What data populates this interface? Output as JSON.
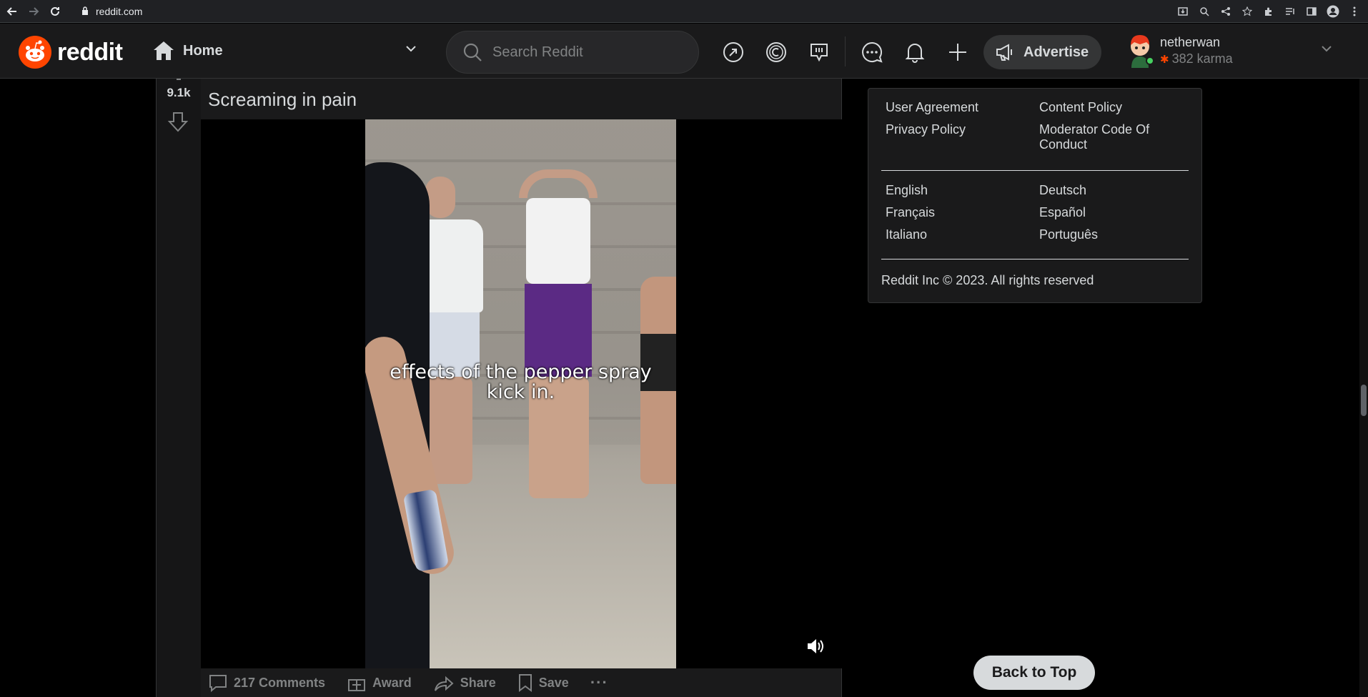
{
  "browser": {
    "url": "reddit.com"
  },
  "header": {
    "logo_text": "reddit",
    "feed_label": "Home",
    "search_placeholder": "Search Reddit",
    "advertise_label": "Advertise",
    "user": {
      "name": "netherwan",
      "karma": "382 karma"
    },
    "brand_color": "#ff4500"
  },
  "post": {
    "score": "9.1k",
    "title": "Screaming in pain",
    "video_caption_line1": "effects of the pepper spray",
    "video_caption_line2": "kick in.",
    "actions": {
      "comments": "217 Comments",
      "award": "Award",
      "share": "Share",
      "save": "Save",
      "more": "···"
    }
  },
  "sidebar": {
    "policy_links": [
      "User Agreement",
      "Content Policy",
      "Privacy Policy",
      "Moderator Code Of Conduct"
    ],
    "languages": [
      "English",
      "Deutsch",
      "Français",
      "Español",
      "Italiano",
      "Português"
    ],
    "copyright": "Reddit Inc © 2023. All rights reserved"
  },
  "back_to_top": "Back to Top"
}
